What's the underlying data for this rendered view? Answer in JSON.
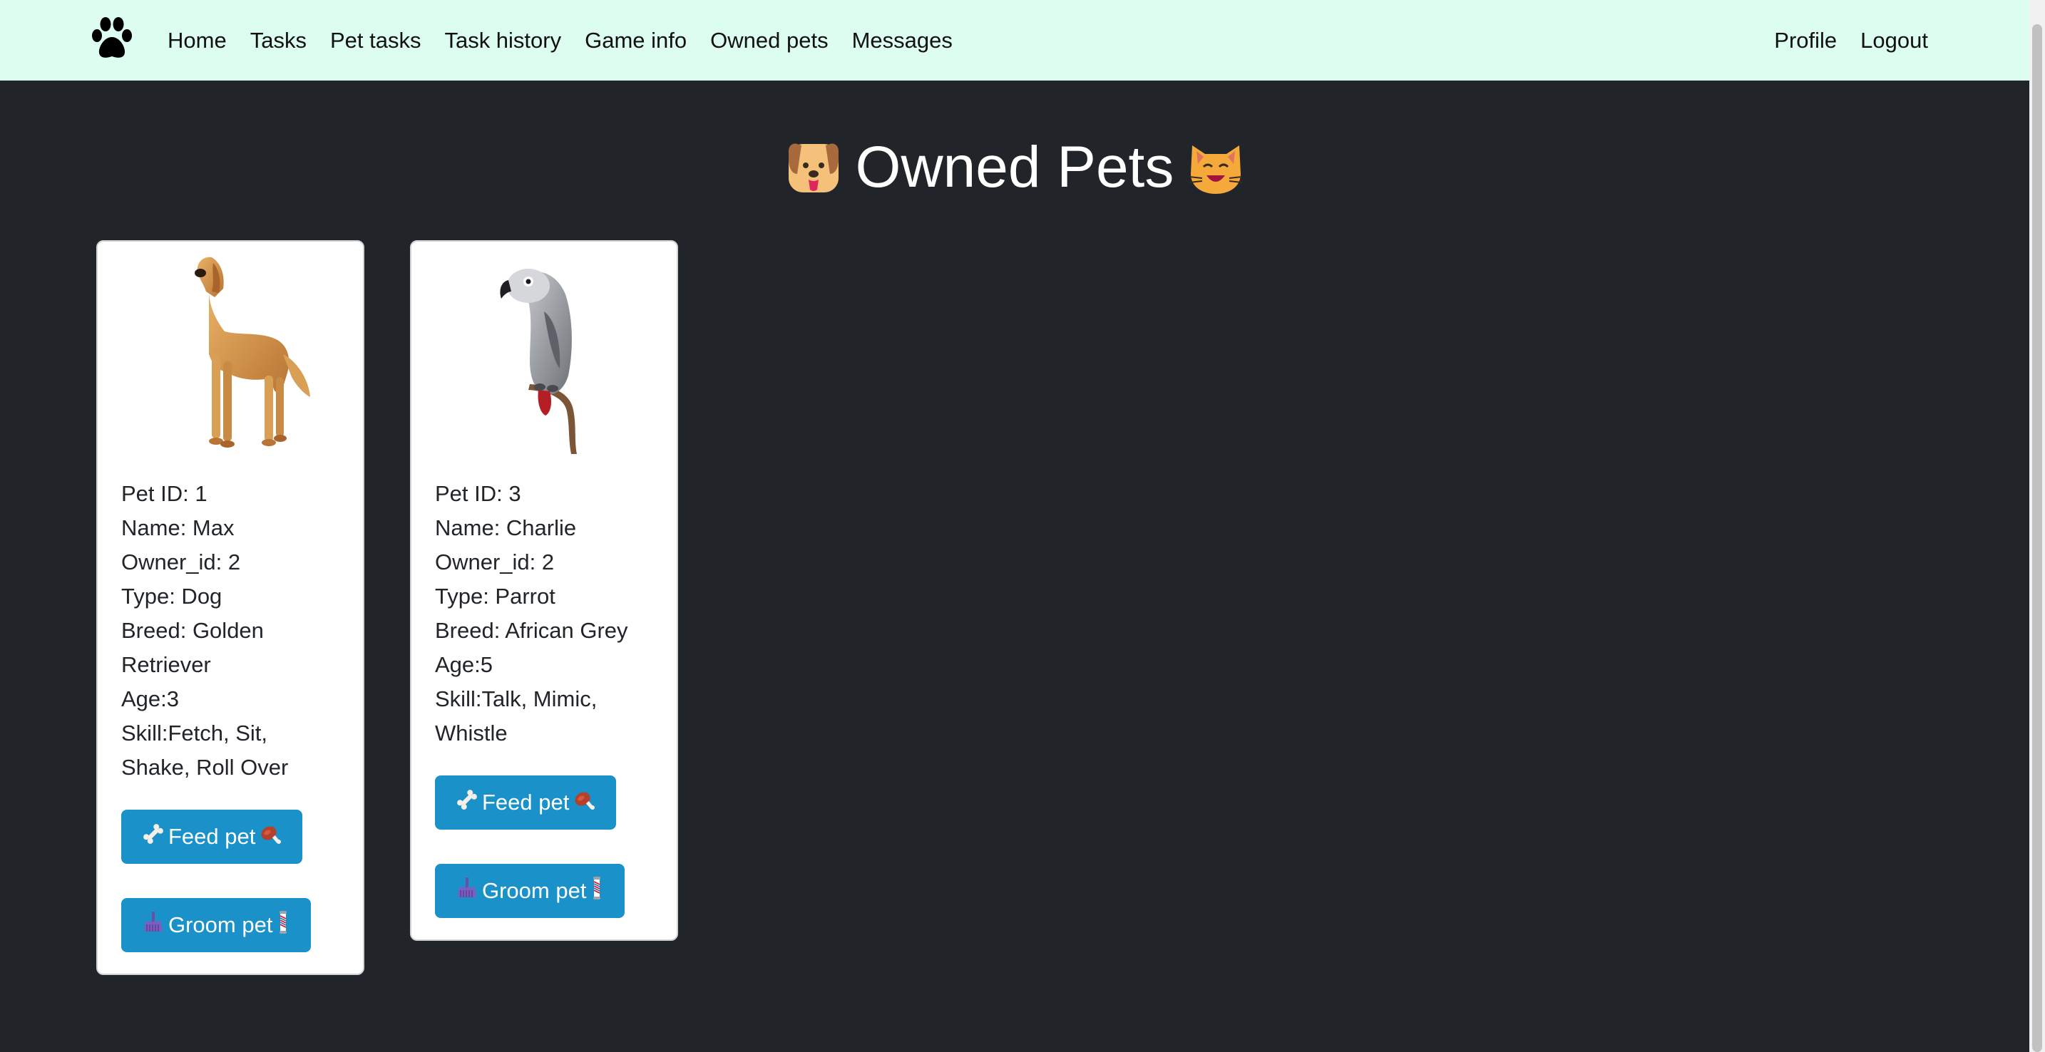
{
  "nav": {
    "brand_icon": "paw-icon",
    "left_links": [
      "Home",
      "Tasks",
      "Pet tasks",
      "Task history",
      "Game info",
      "Owned pets",
      "Messages"
    ],
    "right_links": [
      "Profile",
      "Logout"
    ]
  },
  "page": {
    "title": "Owned Pets",
    "title_left_icon": "dog-face-icon",
    "title_right_icon": "cat-face-icon"
  },
  "pets": [
    {
      "image": "golden-retriever-photo",
      "lines": [
        "Pet ID: 1",
        "Name: Max",
        "Owner_id: 2",
        "Type: Dog",
        "Breed: Golden",
        "Retriever",
        "Age:3",
        "Skill:Fetch, Sit,",
        "Shake, Roll Over"
      ],
      "feed_label": "Feed pet",
      "groom_label": "Groom pet"
    },
    {
      "image": "african-grey-parrot-photo",
      "lines": [
        "Pet ID: 3",
        "Name: Charlie",
        "Owner_id: 2",
        "Type: Parrot",
        "Breed: African Grey",
        "Age:5",
        "Skill:Talk, Mimic,",
        "Whistle"
      ],
      "feed_label": "Feed pet",
      "groom_label": "Groom pet"
    }
  ],
  "colors": {
    "navbar_bg": "#dcfdf0",
    "page_bg": "#212529",
    "button_bg": "#1a91c8"
  }
}
